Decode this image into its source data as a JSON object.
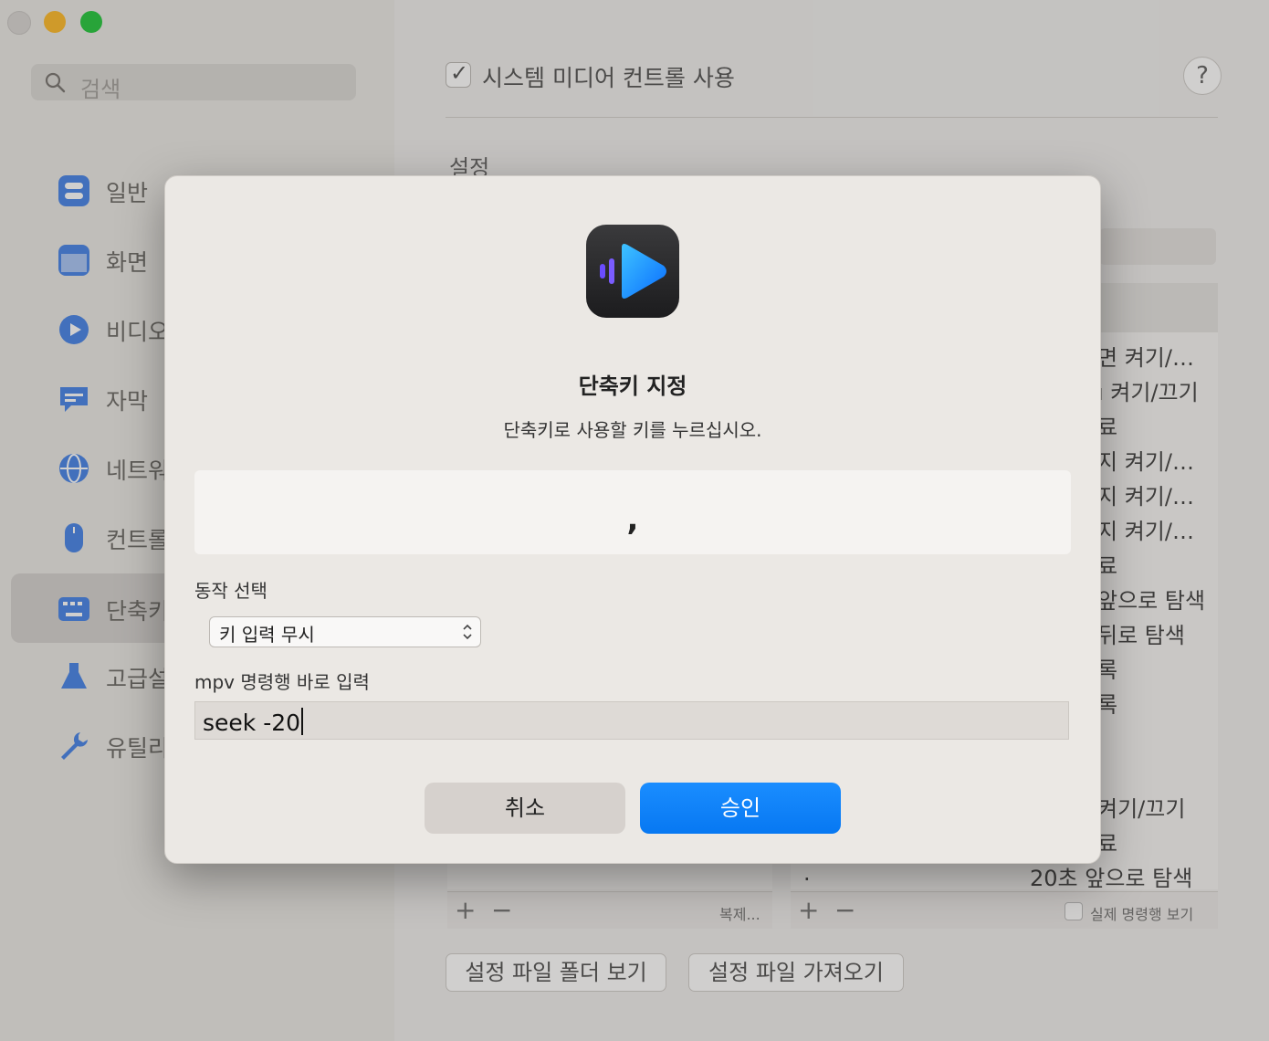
{
  "window": {
    "search_placeholder": "검색"
  },
  "sidebar": {
    "items": [
      {
        "label": "일반",
        "icon": "toggles-icon",
        "color": "#3f7ee8"
      },
      {
        "label": "화면",
        "icon": "window-icon",
        "color": "#3f7ee8"
      },
      {
        "label": "비디오",
        "icon": "play-circle-icon",
        "color": "#3f7ee8"
      },
      {
        "label": "자막",
        "icon": "speech-bubble-icon",
        "color": "#3f7ee8"
      },
      {
        "label": "네트워",
        "icon": "globe-icon",
        "color": "#3f7ee8"
      },
      {
        "label": "컨트롤",
        "icon": "mouse-icon",
        "color": "#3f7ee8"
      },
      {
        "label": "단축키",
        "icon": "keyboard-icon",
        "color": "#3f7ee8"
      },
      {
        "label": "고급설",
        "icon": "flask-icon",
        "color": "#3f7ee8"
      },
      {
        "label": "유틸리",
        "icon": "wrench-icon",
        "color": "#3f7ee8"
      }
    ]
  },
  "content": {
    "media_control_label": "시스템 미디어 컨트롤 사용",
    "help_label": "?",
    "section_title": "설정",
    "bg_rows": [
      "면 켜기/…",
      "ı 켜기/끄기",
      "료",
      "지 켜기/…",
      "지 켜기/…",
      "지 켜기/…",
      "료",
      "앞으로 탐색",
      "뒤로 탐색",
      "록",
      "록",
      "켜기/끄기",
      "료"
    ],
    "last_row_key": ".",
    "last_row_value": "20초  앞으로 탐색",
    "duplicate_label": "복제...",
    "show_command_label": "실제 명령행 보기",
    "open_folder_label": "설정 파일 폴더 보기",
    "import_label": "설정 파일 가져오기"
  },
  "sheet": {
    "title": "단축키 지정",
    "subtitle": "단축키로 사용할 키를 누르십시오.",
    "key_display": ",",
    "action_label": "동작 선택",
    "action_value": "키 입력 무시",
    "command_label": "mpv 명령행 바로 입력",
    "command_value": "seek -20",
    "cancel_label": "취소",
    "ok_label": "승인",
    "accent_color": "#0a84ff"
  }
}
